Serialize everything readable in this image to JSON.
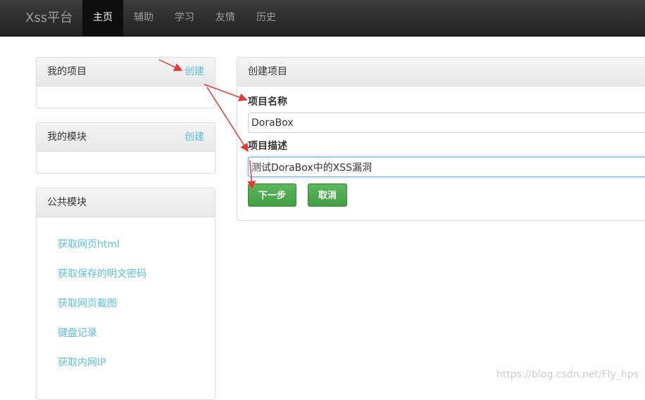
{
  "navbar": {
    "brand": "Xss平台",
    "items": [
      {
        "label": "主页",
        "active": true
      },
      {
        "label": "辅助",
        "active": false
      },
      {
        "label": "学习",
        "active": false
      },
      {
        "label": "友情",
        "active": false
      },
      {
        "label": "历史",
        "active": false
      }
    ]
  },
  "my_projects": {
    "title": "我的项目",
    "create_label": "创建"
  },
  "my_modules": {
    "title": "我的模块",
    "create_label": "创建"
  },
  "public_modules": {
    "title": "公共模块",
    "items": [
      "获取网页html",
      "获取保存的明文密码",
      "获取网页截图",
      "键盘记录",
      "获取内网IP"
    ]
  },
  "create_project": {
    "title": "创建项目",
    "name_label": "项目名称",
    "name_value": "DoraBox",
    "desc_label": "项目描述",
    "desc_value": "测试DoraBox中的XSS漏洞",
    "next_label": "下一步",
    "cancel_label": "取消"
  },
  "watermark": "https://blog.csdn.net/Fly_hps",
  "colors": {
    "link": "#5bc0de",
    "button": "#5cb85c",
    "annotation_arrow": "#e53935"
  }
}
